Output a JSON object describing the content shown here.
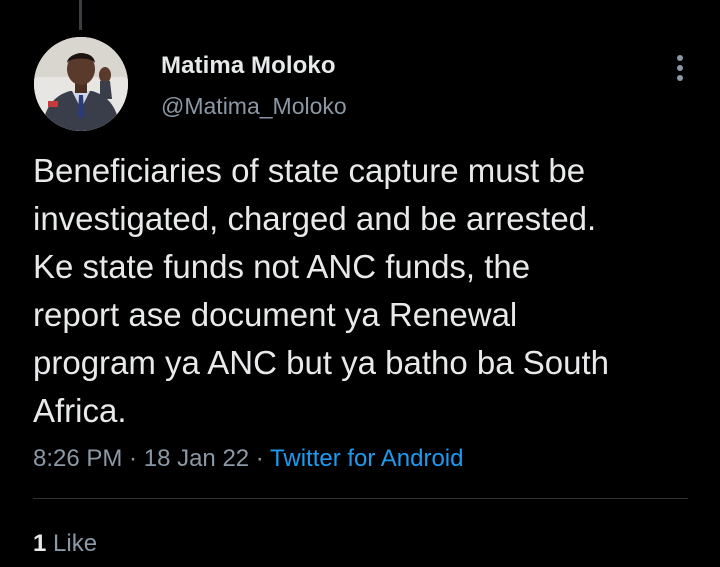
{
  "tweet": {
    "author": {
      "name": "Matima Moloko",
      "handle": "@Matima_Moloko"
    },
    "text": "Beneficiaries of state capture must be\ninvestigated, charged and be arrested.\nKe state funds not ANC funds, the\nreport ase document ya Renewal\nprogram ya ANC but ya batho ba South\nAfrica.",
    "time": "8:26 PM",
    "separator": " · ",
    "date": "18 Jan 22",
    "client": "Twitter for Android",
    "likes": {
      "count": "1",
      "label": " Like"
    }
  },
  "icons": {
    "more": "more-vertical-icon",
    "avatar": "profile-photo"
  },
  "colors": {
    "background": "#000000",
    "primary_text": "#e7e9ea",
    "secondary_text": "#8b98a5",
    "link": "#1d9bf0",
    "divider": "#2f3336"
  }
}
